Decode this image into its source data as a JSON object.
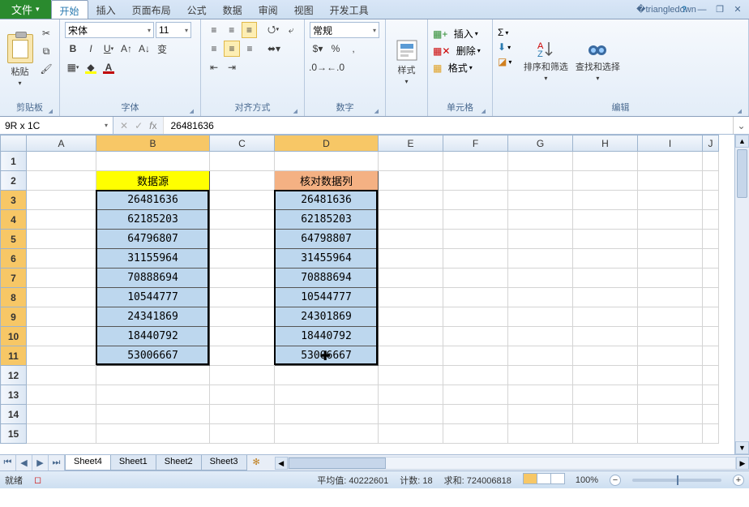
{
  "tabs": {
    "file": "文件",
    "home": "开始",
    "insert": "插入",
    "layout": "页面布局",
    "formulas": "公式",
    "data": "数据",
    "review": "审阅",
    "view": "视图",
    "developer": "开发工具"
  },
  "ribbon": {
    "clipboard": {
      "label": "剪贴板",
      "paste": "粘贴"
    },
    "font": {
      "label": "字体",
      "name": "宋体",
      "size": "11"
    },
    "align": {
      "label": "对齐方式"
    },
    "number": {
      "label": "数字",
      "format": "常规"
    },
    "styles": {
      "label": "样式",
      "btn": "样式"
    },
    "cells": {
      "label": "单元格",
      "insert": "插入",
      "delete": "删除",
      "format": "格式"
    },
    "editing": {
      "label": "编辑",
      "sortfilter": "排序和筛选",
      "findselect": "查找和选择"
    }
  },
  "namebox": "9R x 1C",
  "formula": "26481636",
  "columns": [
    "A",
    "B",
    "C",
    "D",
    "E",
    "F",
    "G",
    "H",
    "I"
  ],
  "headers": {
    "b": "数据源",
    "d": "核对数据列"
  },
  "col_b": [
    "26481636",
    "62185203",
    "64796807",
    "31155964",
    "70888694",
    "10544777",
    "24341869",
    "18440792",
    "53006667"
  ],
  "col_d": [
    "26481636",
    "62185203",
    "64798807",
    "31455964",
    "70888694",
    "10544777",
    "24301869",
    "18440792",
    "53006667"
  ],
  "sheets": [
    "Sheet4",
    "Sheet1",
    "Sheet2",
    "Sheet3"
  ],
  "status": {
    "ready": "就绪",
    "avg_label": "平均值:",
    "avg": "40222601",
    "count_label": "计数:",
    "count": "18",
    "sum_label": "求和:",
    "sum": "724006818",
    "zoom": "100%"
  },
  "colors": {
    "accent": "#2a8a2e",
    "select_bg": "#bdd7ee",
    "hdr_yellow": "#ffff00",
    "hdr_orange": "#f4b183"
  }
}
